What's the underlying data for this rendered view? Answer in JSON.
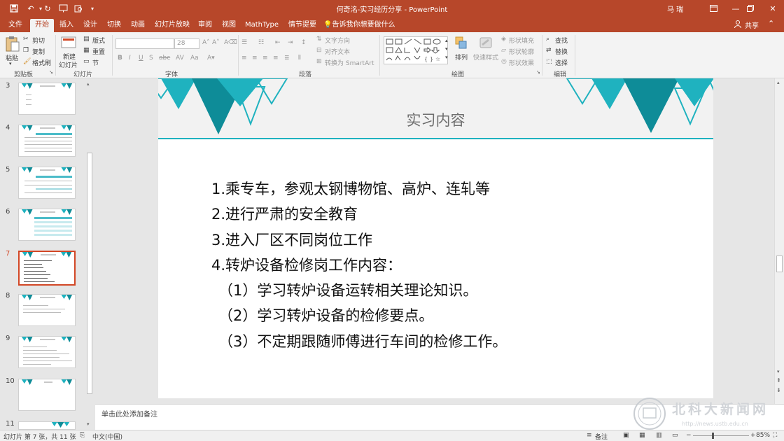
{
  "window": {
    "title": "何奇洺-实习经历分享 - PowerPoint",
    "user": "马 瑞"
  },
  "tabs": [
    "文件",
    "开始",
    "插入",
    "设计",
    "切换",
    "动画",
    "幻灯片放映",
    "审阅",
    "视图",
    "MathType",
    "情节提要"
  ],
  "active_tab": "开始",
  "tell_me": "告诉我你想要做什么",
  "share": "共享",
  "ribbon": {
    "clipboard": {
      "paste": "粘贴",
      "cut": "剪切",
      "copy": "复制",
      "format_painter": "格式刷",
      "label": "剪贴板"
    },
    "slides": {
      "new_slide_1": "新建",
      "new_slide_2": "幻灯片",
      "layout": "版式",
      "reset": "重置",
      "section": "节",
      "label": "幻灯片"
    },
    "font": {
      "font_name": "",
      "font_size": "28",
      "label": "字体"
    },
    "paragraph": {
      "text_direction": "文字方向",
      "align_text": "对齐文本",
      "smartart": "转换为 SmartArt",
      "label": "段落"
    },
    "drawing": {
      "arrange": "排列",
      "quick_styles": "快速样式",
      "shape_fill": "形状填充",
      "shape_outline": "形状轮廓",
      "shape_effects": "形状效果",
      "label": "绘图"
    },
    "editing": {
      "find": "查找",
      "replace": "替换",
      "select": "选择",
      "label": "编辑"
    }
  },
  "thumbnails": [
    {
      "num": "3"
    },
    {
      "num": "4"
    },
    {
      "num": "5"
    },
    {
      "num": "6"
    },
    {
      "num": "7"
    },
    {
      "num": "8"
    },
    {
      "num": "9"
    },
    {
      "num": "10"
    },
    {
      "num": "11"
    }
  ],
  "active_slide": "7",
  "slide": {
    "title": "实习内容",
    "lines": [
      "1.乘专车，参观太钢博物馆、高炉、连轧等",
      "2.进行严肃的安全教育",
      "3.进入厂区不同岗位工作",
      "4.转炉设备检修岗工作内容：",
      "（1）学习转炉设备运转相关理论知识。",
      "（2）学习转炉设备的检修要点。",
      "（3）不定期跟随师傅进行车间的检修工作。"
    ]
  },
  "notes_placeholder": "单击此处添加备注",
  "status": {
    "slide_info": "幻灯片 第 7 张，共 11 张",
    "language": "中文(中国)",
    "notes": "备注",
    "zoom": "85%"
  },
  "watermark": {
    "text": "北科大新闻网",
    "url": "http://news.ustb.edu.cn"
  },
  "colors": {
    "accent": "#b7472a",
    "teal": "#1fb2bf",
    "dark_teal": "#0e8c98"
  }
}
